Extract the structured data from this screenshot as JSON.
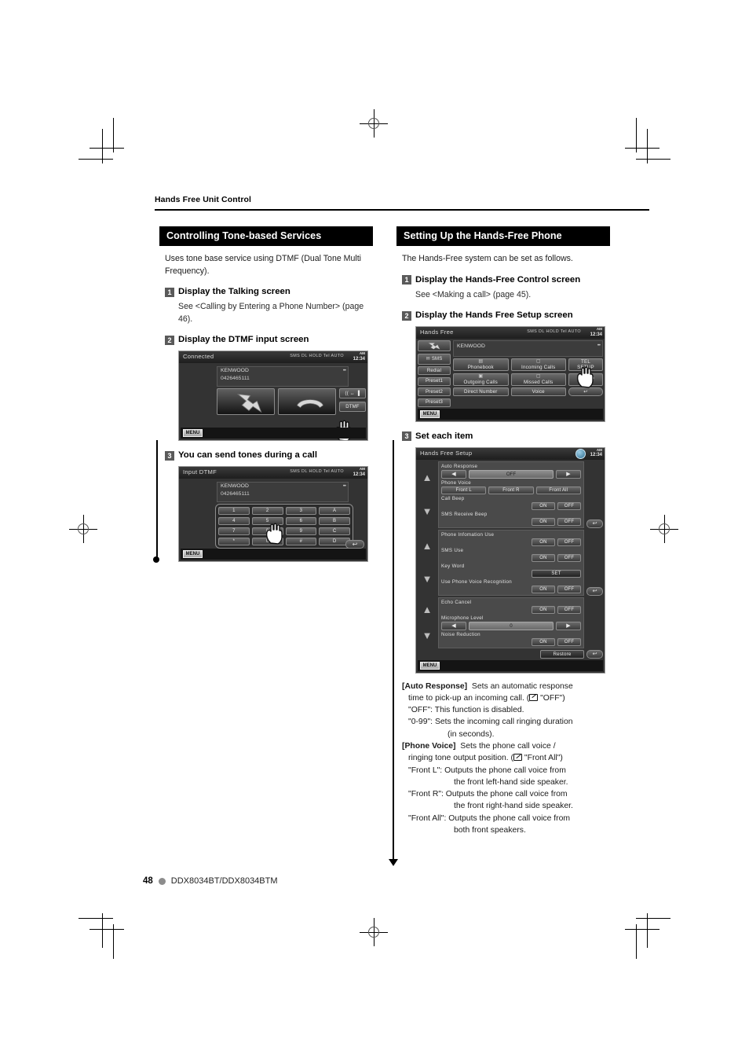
{
  "page": {
    "running_head": "Hands Free Unit Control",
    "number": "48",
    "model": "DDX8034BT/DDX8034BTM"
  },
  "left_column": {
    "section_title": "Controlling Tone-based Services",
    "intro": "Uses tone base service using DTMF (Dual Tone Multi Frequency).",
    "steps": [
      {
        "num": "1",
        "title": "Display the Talking screen",
        "sub": "See <Calling by Entering a Phone Number> (page 46)."
      },
      {
        "num": "2",
        "title": "Display the DTMF input screen"
      },
      {
        "num": "3",
        "title": "You can send tones during a call"
      }
    ],
    "talking_screen": {
      "title": "Connected",
      "status": "SMS DL HOLD Tel  AUTO",
      "ampm": "AM",
      "clock": "12:34",
      "callee_name": "KENWOOD",
      "callee_number": "0426465111",
      "answer_icon": "handset-off-hook-icon",
      "hangup_icon": "handset-on-hook-icon",
      "transfer_label": "(( ↔ ▐",
      "dtmf_label": "DTMF",
      "menu_label": "MENU"
    },
    "dtmf_screen": {
      "title": "Input DTMF",
      "status": "SMS DL HOLD Tel  AUTO",
      "ampm": "AM",
      "clock": "12:34",
      "callee_name": "KENWOOD",
      "callee_number": "0426465111",
      "keys": [
        [
          "1",
          "2",
          "3",
          "A"
        ],
        [
          "4",
          "5",
          "6",
          "B"
        ],
        [
          "7",
          "8",
          "9",
          "C"
        ],
        [
          "*",
          "0",
          "#",
          "D"
        ]
      ],
      "back_label": "↩",
      "menu_label": "MENU"
    }
  },
  "right_column": {
    "section_title": "Setting Up the Hands-Free Phone",
    "intro": "The Hands-Free system can be set as follows.",
    "steps": [
      {
        "num": "1",
        "title": "Display the Hands-Free Control screen",
        "sub": "See <Making a call> (page 45)."
      },
      {
        "num": "2",
        "title": "Display the Hands Free Setup screen"
      },
      {
        "num": "3",
        "title": "Set each item"
      }
    ],
    "control_screen": {
      "title": "Hands Free",
      "status": "SMS DL HOLD Tel  AUTO",
      "ampm": "AM",
      "clock": "12:34",
      "callee_name": "KENWOOD",
      "side_buttons": [
        "SMS",
        "Redial",
        "Preset1",
        "Preset2",
        "Preset3"
      ],
      "phone_icon": "handset-icon",
      "main_buttons": [
        "Phonebook",
        "Incoming Calls",
        "Outgoing Calls",
        "Missed Calls",
        "Direct Number",
        "Voice"
      ],
      "right_buttons": [
        "TEL SETUP",
        "SETUP"
      ],
      "back_label": "↩",
      "menu_label": "MENU"
    },
    "setup_screen": {
      "title": "Hands Free Setup",
      "ampm": "AM",
      "clock": "12:34",
      "panel1": {
        "rows": [
          {
            "label": "Auto Response",
            "type": "spinner",
            "value": "OFF"
          },
          {
            "label": "Phone Voice",
            "type": "three",
            "options": [
              "Front L",
              "Front R",
              "Front All"
            ]
          },
          {
            "label": "Call Beep",
            "type": "onoff",
            "options": [
              "ON",
              "OFF"
            ]
          },
          {
            "label": "SMS Receive Beep",
            "type": "onoff",
            "options": [
              "ON",
              "OFF"
            ]
          }
        ]
      },
      "panel2": {
        "rows": [
          {
            "label": "Phone Infomation Use",
            "type": "onoff",
            "options": [
              "ON",
              "OFF"
            ]
          },
          {
            "label": "SMS Use",
            "type": "onoff",
            "options": [
              "ON",
              "OFF"
            ]
          },
          {
            "label": "Key Word",
            "type": "single",
            "options": [
              "SET"
            ]
          },
          {
            "label": "Use Phone Voice Recognition",
            "type": "onoff",
            "options": [
              "ON",
              "OFF"
            ]
          }
        ]
      },
      "panel3": {
        "rows": [
          {
            "label": "Echo Cancel",
            "type": "onoff",
            "options": [
              "ON",
              "OFF"
            ]
          },
          {
            "label": "Microphone Level",
            "type": "spinner",
            "value": "0"
          },
          {
            "label": "Noise Reduction",
            "type": "onoff",
            "options": [
              "ON",
              "OFF"
            ]
          }
        ],
        "restore_label": "Restore",
        "back_label": "↩"
      },
      "menu_label": "MENU"
    },
    "descriptions": {
      "auto_response": {
        "term": "[Auto Response]",
        "line1": "Sets an automatic response",
        "line2": "time to pick-up an incoming call. (",
        "line2b": "\"OFF\")",
        "line3": "\"OFF\":  This function is disabled.",
        "line4": "\"0-99\":  Sets the incoming call ringing duration",
        "line5": "(in seconds)."
      },
      "phone_voice": {
        "term": "[Phone Voice]",
        "line1": "Sets the phone call voice /",
        "line2": "ringing tone output position. (",
        "line2b": "\"Front All\")",
        "line3": "\"Front L\":  Outputs the phone call voice from",
        "line4": "the front left-hand side speaker.",
        "line5": "\"Front R\":  Outputs the phone call voice from",
        "line6": "the front right-hand side speaker.",
        "line7": "\"Front All\":  Outputs the phone call voice from",
        "line8": "both front speakers."
      }
    }
  }
}
